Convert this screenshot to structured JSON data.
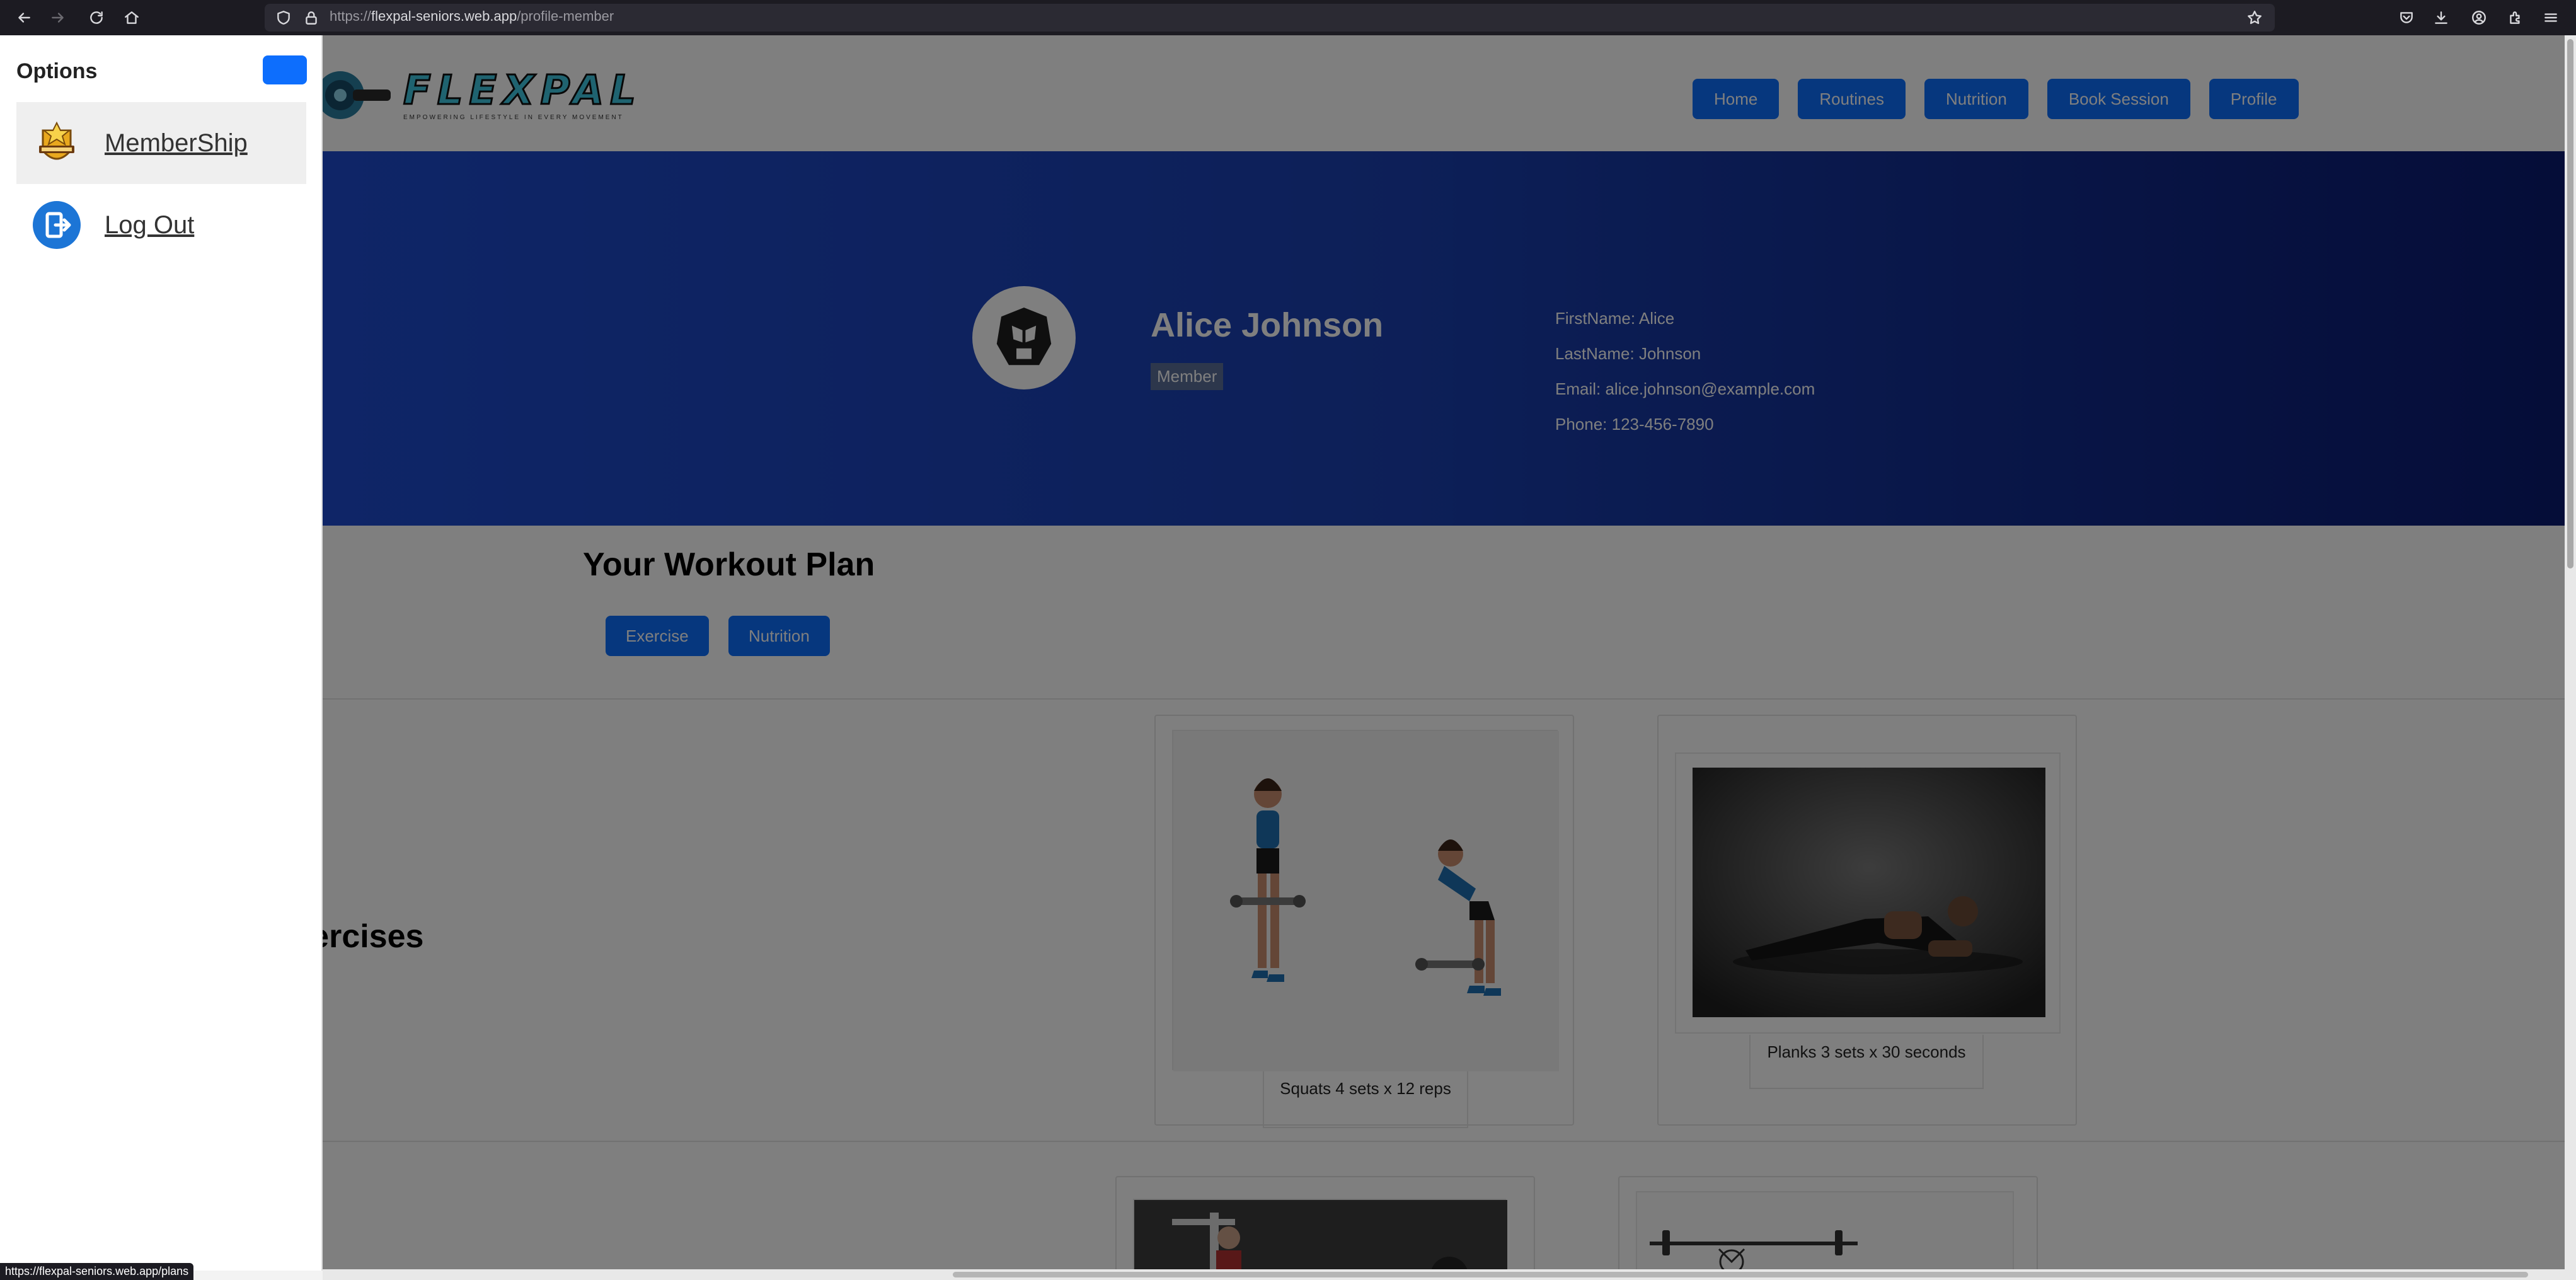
{
  "browser": {
    "url_protocol": "https://",
    "url_domain": "flexpal-seniors.web.app",
    "url_path": "/profile-member",
    "status_url": "https://flexpal-seniors.web.app/plans"
  },
  "site": {
    "logo_title": "FLEXPAL",
    "logo_tagline": "EMPOWERING LIFESTYLE IN EVERY MOVEMENT",
    "nav": [
      "Home",
      "Routines",
      "Nutrition",
      "Book Session",
      "Profile"
    ]
  },
  "profile": {
    "name": "Alice Johnson",
    "role": "Member",
    "first_name": "FirstName: Alice",
    "last_name": "LastName: Johnson",
    "email": "Email: alice.johnson@example.com",
    "phone": "Phone: 123-456-7890"
  },
  "plan": {
    "title": "Your Workout Plan",
    "exercise_label": "Exercise",
    "nutrition_label": "Nutrition"
  },
  "exercises": {
    "section_title_visible": "led Exercises",
    "cards": [
      {
        "caption": "Squats 4 sets x 12 reps"
      },
      {
        "caption": "Planks 3 sets x 30 seconds"
      }
    ]
  },
  "offcanvas": {
    "title": "Options",
    "items": [
      {
        "label": "MemberShip",
        "icon": "membership-badge-icon"
      },
      {
        "label": "Log Out",
        "icon": "logout-icon"
      }
    ]
  },
  "colors": {
    "primary": "#0d6efd",
    "hero_start": "#1f4fd8",
    "hero_end": "#0a1a70",
    "chrome_bg": "#1c1b22"
  }
}
